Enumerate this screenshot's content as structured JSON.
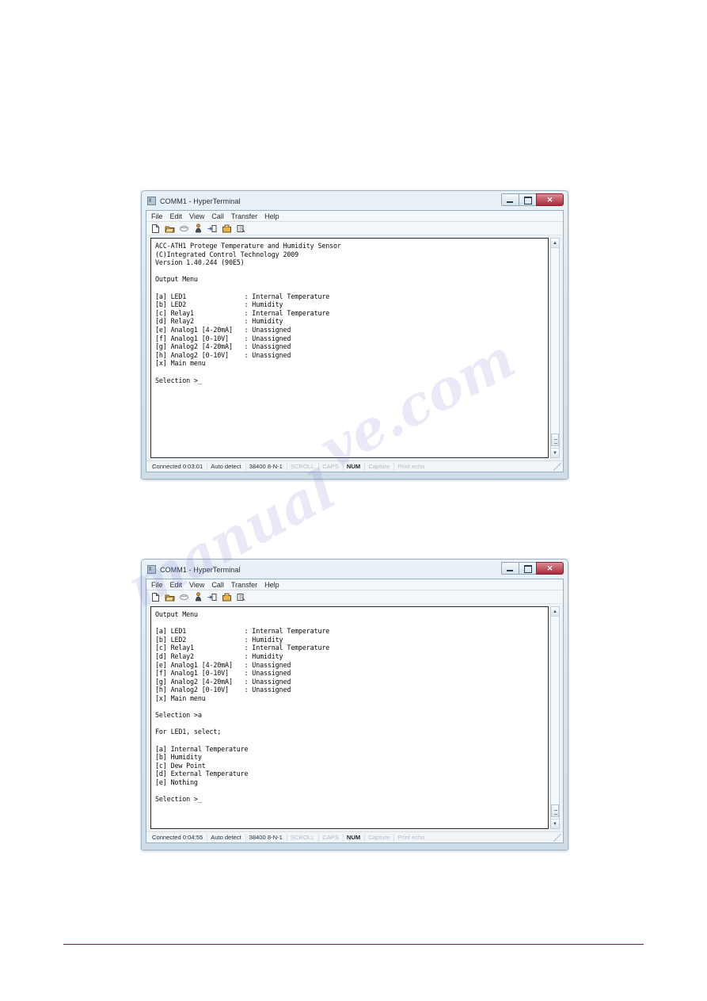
{
  "page": {
    "accent_red": "#7b1f33",
    "watermarks": [
      "ve.com",
      "manual"
    ]
  },
  "windows": [
    {
      "title": "COMM1 - HyperTerminal",
      "menu": [
        "File",
        "Edit",
        "View",
        "Call",
        "Transfer",
        "Help"
      ],
      "toolbar_icons": [
        "new-icon",
        "open-icon",
        "disconnect-icon",
        "call-icon",
        "send-file-icon",
        "receive-file-icon",
        "properties-icon"
      ],
      "controls": {
        "minimize": "minimize-button",
        "restore": "restore-button",
        "close_label": "✕"
      },
      "terminal_text": "ACC-ATH1 Protege Temperature and Humidity Sensor\n(C)Integrated Control Technology 2009\nVersion 1.40.244 (90E5)\n\nOutput Menu\n\n[a] LED1               : Internal Temperature\n[b] LED2               : Humidity\n[c] Relay1             : Internal Temperature\n[d] Relay2             : Humidity\n[e] Analog1 [4-20mA]   : Unassigned\n[f] Analog1 [0-10V]    : Unassigned\n[g] Analog2 [4-20mA]   : Unassigned\n[h] Analog2 [0-10V]    : Unassigned\n[x] Main menu\n\nSelection >_",
      "status": {
        "connected": "Connected 0:03:01",
        "detect": "Auto detect",
        "settings": "38400 8-N-1",
        "scroll": "SCROLL",
        "caps": "CAPS",
        "num": "NUM",
        "capture": "Capture",
        "print_echo": "Print echo"
      }
    },
    {
      "title": "COMM1 - HyperTerminal",
      "menu": [
        "File",
        "Edit",
        "View",
        "Call",
        "Transfer",
        "Help"
      ],
      "toolbar_icons": [
        "new-icon",
        "open-icon",
        "disconnect-icon",
        "call-icon",
        "send-file-icon",
        "receive-file-icon",
        "properties-icon"
      ],
      "controls": {
        "minimize": "minimize-button",
        "restore": "restore-button",
        "close_label": "✕"
      },
      "terminal_text": "Output Menu\n\n[a] LED1               : Internal Temperature\n[b] LED2               : Humidity\n[c] Relay1             : Internal Temperature\n[d] Relay2             : Humidity\n[e] Analog1 [4-20mA]   : Unassigned\n[f] Analog1 [0-10V]    : Unassigned\n[g] Analog2 [4-20mA]   : Unassigned\n[h] Analog2 [0-10V]    : Unassigned\n[x] Main menu\n\nSelection >a\n\nFor LED1, select;\n\n[a] Internal Temperature\n[b] Humidity\n[c] Dew Point\n[d] External Temperature\n[e] Nothing\n\nSelection >_",
      "status": {
        "connected": "Connected 0:04:55",
        "detect": "Auto detect",
        "settings": "38400 8-N-1",
        "scroll": "SCROLL",
        "caps": "CAPS",
        "num": "NUM",
        "capture": "Capture",
        "print_echo": "Print echo"
      }
    }
  ]
}
